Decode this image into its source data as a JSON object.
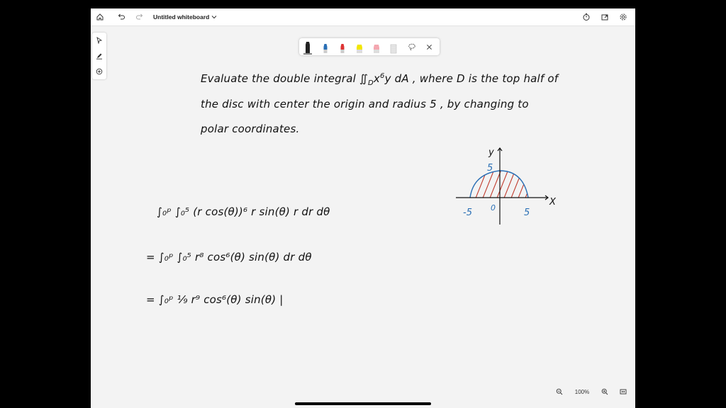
{
  "window": {
    "title": "Untitled whiteboard"
  },
  "problem": {
    "line1": "Evaluate the double integral ∬",
    "line1_sub": "D",
    "line1_mid": "x",
    "line1_sup": "6",
    "line1_end": "y dA , where D is the top half of",
    "line2": "the disc with center the origin and radius 5 , by changing to",
    "line3": "polar coordinates."
  },
  "work": {
    "step1": "∫₀ᵖ ∫₀⁵ (r cos(θ))⁶ r sin(θ) r dr dθ",
    "step2": "= ∫₀ᵖ ∫₀⁵ r⁸ cos⁶(θ) sin(θ) dr dθ",
    "step3": "= ∫₀ᵖ ¹⁄₉ r⁹ cos⁶(θ) sin(θ) |"
  },
  "graph": {
    "y_label": "y",
    "x_label": "X",
    "y_tick": "5",
    "x_left": "-5",
    "x_right": "5",
    "origin": "0"
  },
  "zoom": {
    "level": "100%"
  },
  "colors": {
    "ink": "#111111",
    "blue_ink": "#2a6fb5",
    "red_ink": "#c0392b"
  }
}
